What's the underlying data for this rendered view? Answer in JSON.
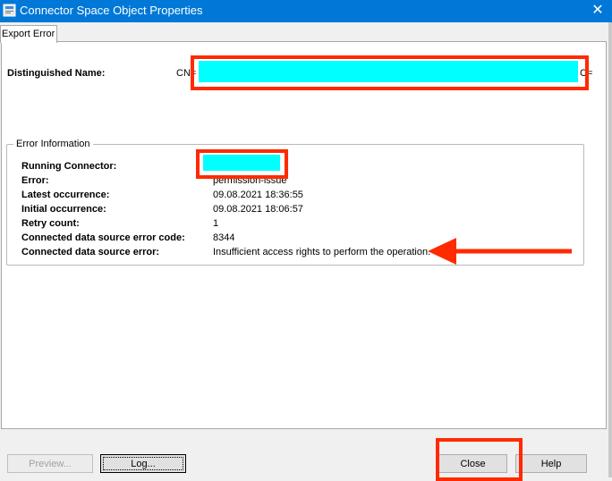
{
  "window": {
    "title": "Connector Space Object Properties",
    "close_glyph": "✕"
  },
  "tabs": [
    {
      "label": "Export Error"
    }
  ],
  "distinguished_name": {
    "label": "Distinguished Name:",
    "prefix": "CN=",
    "suffix": "C="
  },
  "error_info": {
    "legend": "Error Information",
    "running_connector_label": "Running Connector:",
    "rows": [
      {
        "label": "Error:",
        "value": "permission-issue"
      },
      {
        "label": "Latest occurrence:",
        "value": "09.08.2021 18:36:55"
      },
      {
        "label": "Initial occurrence:",
        "value": "09.08.2021 18:06:57"
      },
      {
        "label": "Retry count:",
        "value": "1"
      },
      {
        "label": "Connected data source error code:",
        "value": "8344"
      },
      {
        "label": "Connected data source error:",
        "value": "Insufficient access rights to perform the operation."
      }
    ]
  },
  "buttons": {
    "preview": "Preview...",
    "log": "Log...",
    "close": "Close",
    "help": "Help"
  },
  "colors": {
    "titlebar": "#0078d7",
    "highlight": "#ff2a00",
    "redaction": "#00ffff"
  }
}
